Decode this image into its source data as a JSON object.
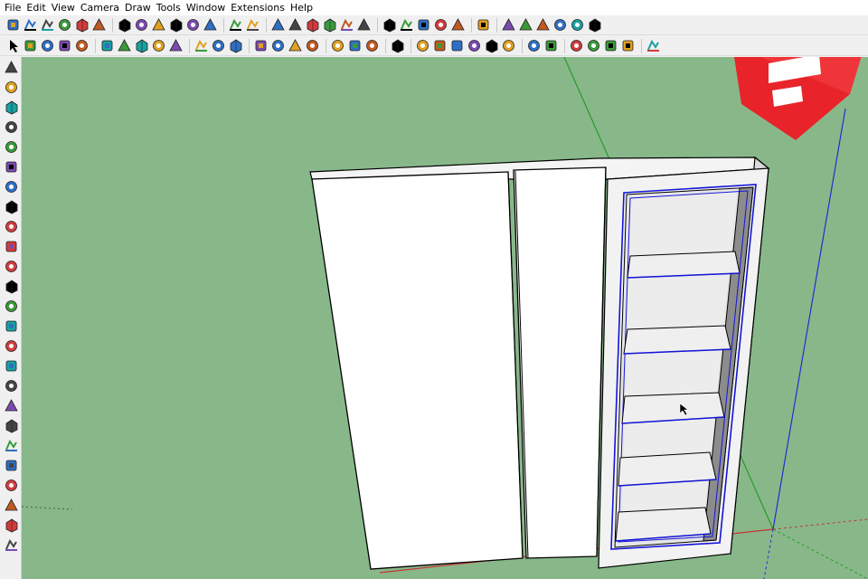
{
  "menu": [
    "File",
    "Edit",
    "View",
    "Camera",
    "Draw",
    "Tools",
    "Window",
    "Extensions",
    "Help"
  ],
  "colors": {
    "viewport": "#88b88a",
    "selection": "#1414d8",
    "axis_red": "#c83232",
    "axis_green": "#2a9a2a",
    "axis_blue": "#2a2ad0",
    "logo_red": "#e8242a"
  },
  "toolbar_top": [
    [
      "cube-iso-icon",
      "cube-top-icon",
      "cube-front-icon",
      "cube-right-icon",
      "cube-back-icon",
      "cube-left-icon"
    ],
    [
      "section-plane-icon",
      "section-cut-icon",
      "section-fill-icon",
      "section-toggle-icon",
      "section-display-icon",
      "section-face-icon"
    ],
    [
      "warning-icon",
      "tools-icon"
    ],
    [
      "component-icon",
      "book-icon",
      "house-icon",
      "gallery-icon",
      "home-icon",
      "store-icon"
    ],
    [
      "extension-a-icon",
      "extension-b-icon",
      "extension-c-icon",
      "extension-d-icon",
      "extension-e-icon"
    ],
    [
      "flask-icon"
    ],
    [
      "ruby-icon",
      "ruby-console-icon",
      "dynamic-component-icon",
      "dc-attributes-icon",
      "dc-options-icon",
      "presentation-icon"
    ]
  ],
  "toolbar_main": [
    [
      "select-icon",
      "eraser-icon",
      "pencil-icon",
      "arc-icon",
      "rectangle-icon"
    ],
    [
      "push-pull-icon",
      "follow-me-icon",
      "move-icon",
      "rotate-icon",
      "scale-icon"
    ],
    [
      "tape-measure-icon",
      "text-icon",
      "paint-bucket-icon"
    ],
    [
      "orbit-icon",
      "pan-icon",
      "zoom-icon",
      "zoom-extents-icon"
    ],
    [
      "warehouse-icon",
      "extension-warehouse-icon",
      "send-to-layout-icon"
    ],
    [
      "extension-manager-icon"
    ],
    [
      "sandbox-mesh-icon",
      "sandbox-smoove-icon",
      "sandbox-stamp-icon",
      "sandbox-drape-icon",
      "sandbox-detail-icon",
      "sandbox-flip-icon"
    ],
    [
      "solid-union-icon",
      "solid-outer-shell-icon"
    ],
    [
      "style-xray-icon",
      "style-back-edges-icon",
      "style-wireframe-icon",
      "style-hidden-line-icon"
    ],
    [
      "shadow-icon"
    ]
  ],
  "toolbar_left": [
    "shield-icon",
    "refresh-icon",
    "camera-position-icon",
    "walk-icon",
    "blank-icon",
    "photo-icon",
    "print-icon",
    "shield-plus-icon",
    "tree-icon",
    "capture-icon",
    "audio-icon",
    "settings-sliders-icon",
    "adjust-sliders-icon",
    "chat-icon",
    "info-icon",
    "panel-a-icon",
    "panel-b-icon",
    "panel-c-icon",
    "panel-d-icon",
    "panel-e-icon",
    "panel-f-icon",
    "panel-g-icon",
    "panel-h-icon",
    "panel-i-icon",
    "panel-j-icon"
  ],
  "scene": {
    "model": "wardrobe",
    "doors": 2,
    "shelves": 5,
    "open_section_selected": true
  },
  "cursor": "select-cursor-icon"
}
